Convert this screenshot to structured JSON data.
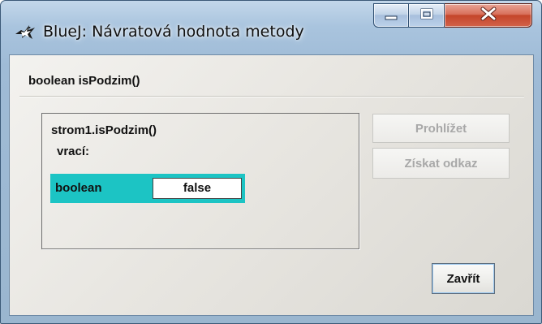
{
  "window": {
    "title": "BlueJ:  Návratová hodnota metody",
    "app_icon": "bluej-bird-icon",
    "caption_buttons": {
      "minimize_icon": "minimize-icon",
      "maximize_icon": "maximize-icon",
      "close_icon": "close-icon"
    }
  },
  "dialog": {
    "method_signature": "boolean isPodzim()",
    "call_expression": "strom1.isPodzim()",
    "returns_label": "vrací:",
    "result": {
      "type": "boolean",
      "value": "false",
      "highlight_color": "#1cc4c4"
    },
    "buttons": {
      "inspect": "Prohlížet",
      "get_reference": "Získat odkaz",
      "close": "Zavřít"
    }
  }
}
